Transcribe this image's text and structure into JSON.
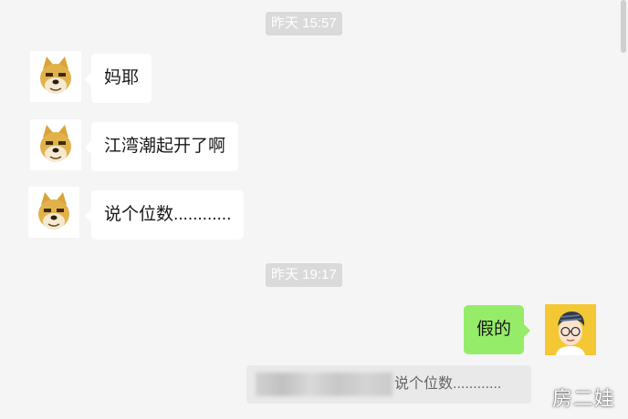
{
  "messages": {
    "timestamp_1": "昨天 15:57",
    "msg_1": "妈耶",
    "msg_2": "江湾潮起开了啊",
    "msg_3": "说个位数............",
    "timestamp_2": "昨天 19:17",
    "reply": "假的"
  },
  "quote": {
    "text": "说个位数............"
  },
  "watermark": "房二娃",
  "icons": {
    "other_avatar": "doge-avatar-icon",
    "self_avatar": "cartoon-person-avatar-icon"
  },
  "colors": {
    "background": "#f5f5f5",
    "incoming_bubble": "#ffffff",
    "outgoing_bubble": "#95ec69",
    "timestamp_bg": "#dadada"
  }
}
